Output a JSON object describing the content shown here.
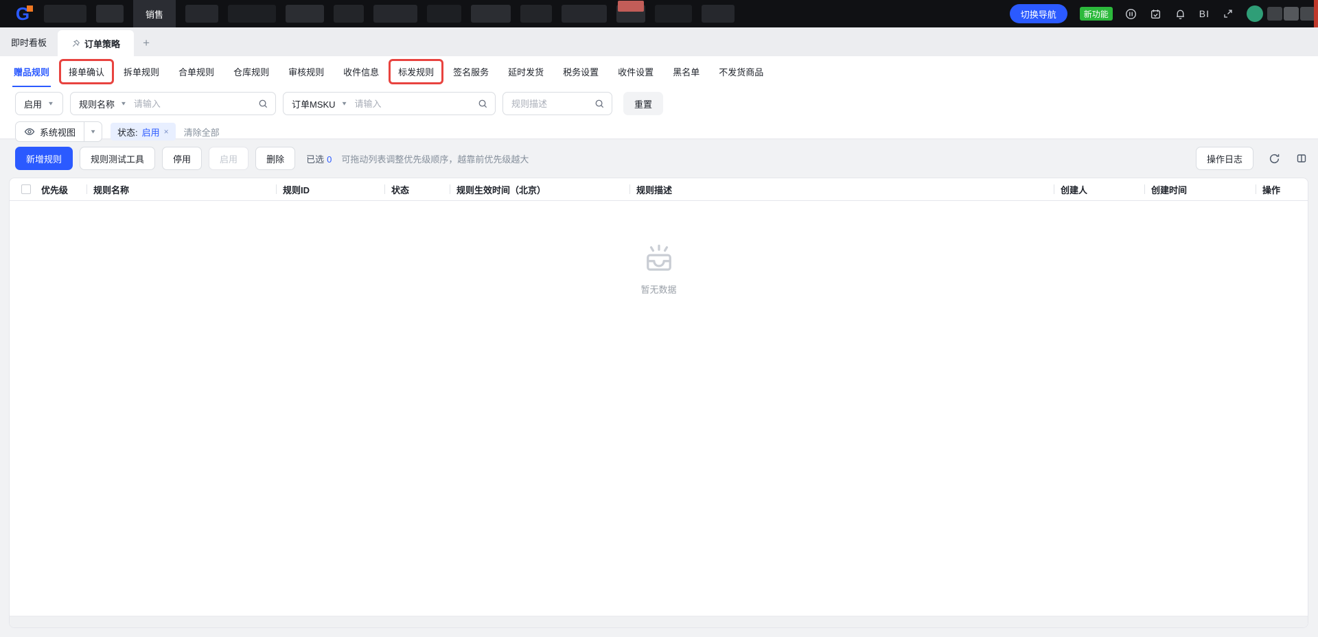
{
  "topbar": {
    "selected_menu": "销售",
    "nav_toggle_button": "切换导航",
    "new_feature_badge": "新功能",
    "bi_label": "BI"
  },
  "tabs": {
    "items": [
      {
        "label": "即时看板"
      },
      {
        "label": "订单策略"
      }
    ],
    "add_button": "+"
  },
  "subtabs": {
    "items": [
      {
        "label": "赠品规则"
      },
      {
        "label": "接单确认"
      },
      {
        "label": "拆单规则"
      },
      {
        "label": "合单规则"
      },
      {
        "label": "仓库规则"
      },
      {
        "label": "审核规则"
      },
      {
        "label": "收件信息"
      },
      {
        "label": "标发规则"
      },
      {
        "label": "签名服务"
      },
      {
        "label": "延时发货"
      },
      {
        "label": "税务设置"
      },
      {
        "label": "收件设置"
      },
      {
        "label": "黑名单"
      },
      {
        "label": "不发货商品"
      }
    ]
  },
  "filters": {
    "status_select_value": "启用",
    "rule_name_select_value": "规则名称",
    "rule_name_placeholder": "请输入",
    "msku_select_value": "订单MSKU",
    "msku_placeholder": "请输入",
    "desc_placeholder": "规则描述",
    "reset_button": "重置"
  },
  "view_row": {
    "view_select_value": "系统视图",
    "tag_label": "状态:",
    "tag_value": "启用",
    "tag_close": "×",
    "clear_all": "清除全部"
  },
  "toolbar": {
    "add_rule_button": "新增规则",
    "test_tool_button": "规则测试工具",
    "disable_button": "停用",
    "enable_button": "启用",
    "delete_button": "删除",
    "selected_label": "已选",
    "selected_count": "0",
    "drag_hint": "可拖动列表调整优先级顺序，越靠前优先级越大",
    "operation_log_button": "操作日志"
  },
  "table": {
    "columns": [
      {
        "label": "优先级"
      },
      {
        "label": "规则名称"
      },
      {
        "label": "规则ID"
      },
      {
        "label": "状态"
      },
      {
        "label": "规则生效时间（北京）"
      },
      {
        "label": "规则描述"
      },
      {
        "label": "创建人"
      },
      {
        "label": "创建时间"
      },
      {
        "label": "操作"
      }
    ],
    "empty_text": "暂无数据"
  },
  "colors": {
    "accent_blue": "#2b5aff",
    "badge_green": "#2cb93c",
    "annotation_red": "#e8433f",
    "topbar_bg": "#101114",
    "page_bg": "#f1f2f4"
  }
}
